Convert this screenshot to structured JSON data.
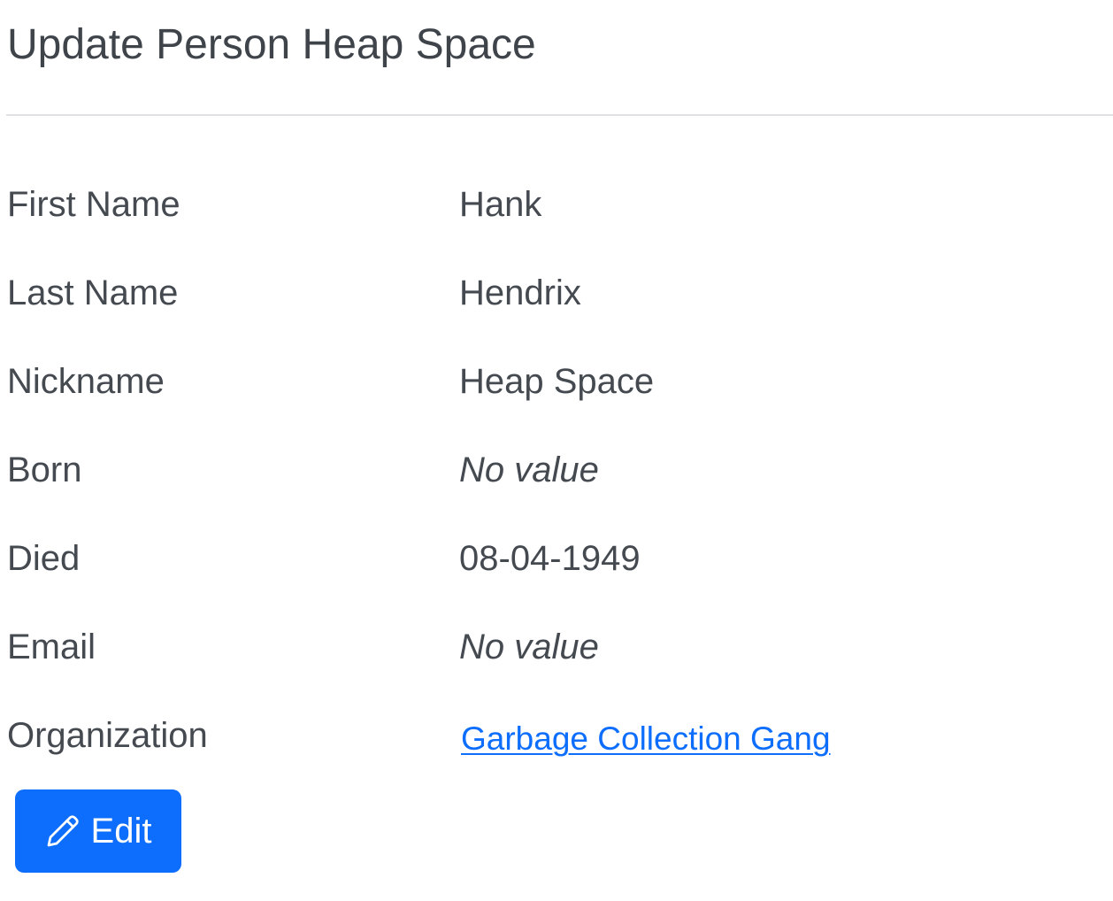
{
  "page": {
    "title": "Update Person Heap Space"
  },
  "details": {
    "rows": [
      {
        "label": "First Name",
        "value": "Hank"
      },
      {
        "label": "Last Name",
        "value": "Hendrix"
      },
      {
        "label": "Nickname",
        "value": "Heap Space"
      },
      {
        "label": "Born",
        "value": "No value"
      },
      {
        "label": "Died",
        "value": "08-04-1949"
      },
      {
        "label": "Email",
        "value": "No value"
      },
      {
        "label": "Organization",
        "value": "Garbage Collection Gang"
      }
    ]
  },
  "actions": {
    "edit_label": "Edit",
    "edit_icon": "pencil-icon"
  },
  "colors": {
    "primary": "#0d6efd",
    "text": "#454a51",
    "divider": "#dfe1e4"
  }
}
